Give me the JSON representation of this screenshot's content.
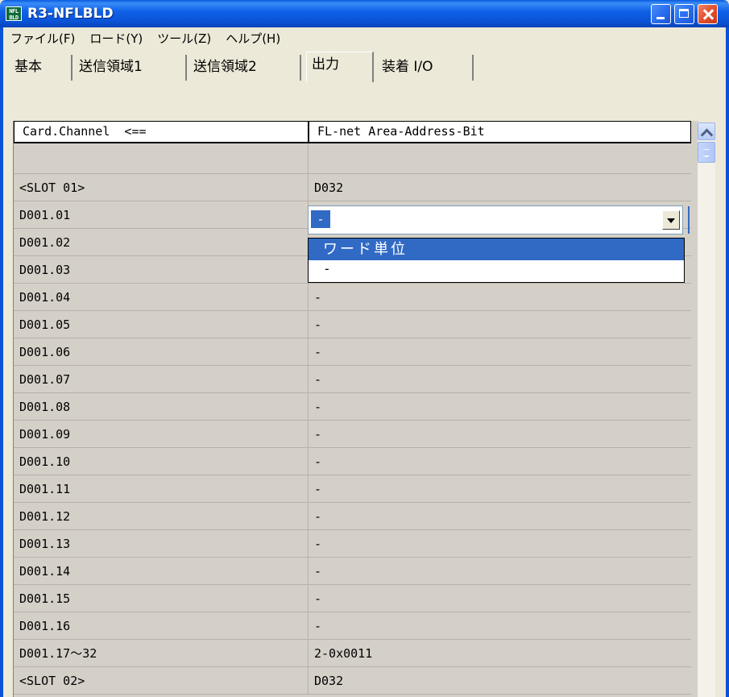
{
  "window": {
    "title": "R3-NFLBLD",
    "icon_label_top": "NFL",
    "icon_label_bottom": "BLD",
    "icons": [
      "app-icon",
      "minimize-icon",
      "maximize-icon",
      "close-icon"
    ]
  },
  "menu": [
    "ファイル(F)",
    "ロード(Y)",
    "ツール(Z)",
    "ヘルプ(H)"
  ],
  "tabs": [
    "基本",
    "送信領域1",
    "送信領域2",
    "出力",
    "装着 I/O"
  ],
  "active_tab": "出力",
  "grid": {
    "columns": [
      "Card.Channel  <==",
      "FL-net Area-Address-Bit"
    ],
    "rows": [
      [
        "",
        ""
      ],
      [
        "<SLOT 01>",
        "D032"
      ],
      [
        "D001.01",
        "-"
      ],
      [
        "D001.02",
        ""
      ],
      [
        "D001.03",
        ""
      ],
      [
        "D001.04",
        "-"
      ],
      [
        "D001.05",
        "-"
      ],
      [
        "D001.06",
        "-"
      ],
      [
        "D001.07",
        "-"
      ],
      [
        "D001.08",
        "-"
      ],
      [
        "D001.09",
        "-"
      ],
      [
        "D001.10",
        "-"
      ],
      [
        "D001.11",
        "-"
      ],
      [
        "D001.12",
        "-"
      ],
      [
        "D001.13",
        "-"
      ],
      [
        "D001.14",
        "-"
      ],
      [
        "D001.15",
        "-"
      ],
      [
        "D001.16",
        "-"
      ],
      [
        "D001.17～32",
        "2-0x0011"
      ],
      [
        "<SLOT 02>",
        "D032"
      ]
    ]
  },
  "editor": {
    "value": "-",
    "options": [
      "ワード単位",
      "-"
    ],
    "highlighted": "ワード単位"
  },
  "colors": {
    "titlebar": "#0a52d6",
    "selection": "#316ac5",
    "grid_bg": "#d4d0c8"
  }
}
